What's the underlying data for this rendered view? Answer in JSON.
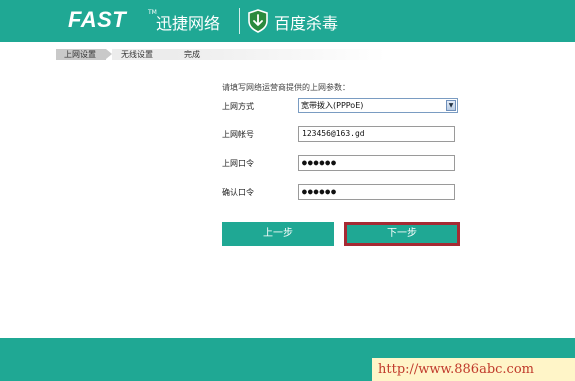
{
  "header": {
    "logo": "FAST",
    "logo_tm": "TM",
    "brand_cn": "迅捷网络",
    "partner": "百度杀毒",
    "partner_icon": "baidu-shield-icon"
  },
  "steps": [
    {
      "label": "上网设置",
      "active": true
    },
    {
      "label": "无线设置",
      "active": false
    },
    {
      "label": "完成",
      "active": false
    }
  ],
  "form": {
    "intro": "请填写网络运营商提供的上网参数：",
    "mode_label": "上网方式",
    "mode_value": "宽带拨入(PPPoE)",
    "account_label": "上网帐号",
    "account_value": "123456@163.gd",
    "password_label": "上网口令",
    "password_value": "●●●●●●",
    "confirm_label": "确认口令",
    "confirm_value": "●●●●●●"
  },
  "buttons": {
    "prev": "上一步",
    "next": "下一步"
  },
  "watermark": "http://www.886abc.com",
  "colors": {
    "brand": "#1fa894",
    "highlight": "#a62a33"
  }
}
